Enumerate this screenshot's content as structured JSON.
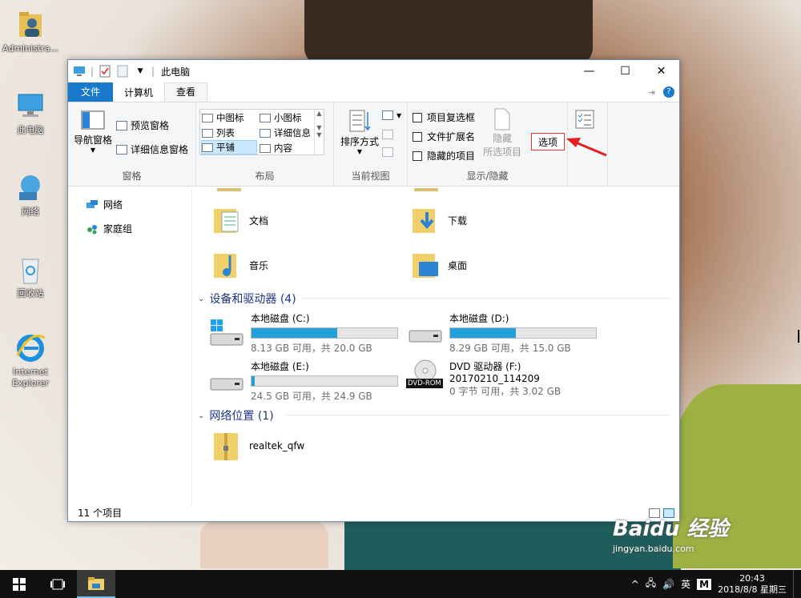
{
  "desktop": {
    "icons": [
      {
        "label": "Administra..."
      },
      {
        "label": "此电脑"
      },
      {
        "label": "网络"
      },
      {
        "label": "回收站"
      },
      {
        "label": "Internet Explorer"
      }
    ]
  },
  "window": {
    "title": "此电脑",
    "tabs": {
      "file": "文件",
      "computer": "计算机",
      "view": "查看"
    },
    "ribbon": {
      "panes": {
        "nav_pane": "导航窗格",
        "preview_pane": "预览窗格",
        "details_pane": "详细信息窗格",
        "label": "窗格"
      },
      "layout": {
        "items": [
          "中图标",
          "小图标",
          "列表",
          "详细信息",
          "平铺",
          "内容"
        ],
        "label": "布局"
      },
      "current_view": {
        "sort_by": "排序方式",
        "label": "当前视图"
      },
      "show_hide": {
        "item_checkboxes": "项目复选框",
        "file_extensions": "文件扩展名",
        "hidden_items": "隐藏的项目",
        "hide_selected_line1": "隐藏",
        "hide_selected_line2": "所选项目",
        "label": "显示/隐藏"
      },
      "options": "选项"
    },
    "nav": [
      {
        "label": "网络"
      },
      {
        "label": "家庭组"
      }
    ],
    "folders": [
      {
        "label": "文档"
      },
      {
        "label": "下载"
      },
      {
        "label": "音乐"
      },
      {
        "label": "桌面"
      }
    ],
    "devices_header": "设备和驱动器 (4)",
    "drives": [
      {
        "name": "本地磁盘 (C:)",
        "info": "8.13 GB 可用，共 20.0 GB",
        "used_fraction": 0.59
      },
      {
        "name": "本地磁盘 (D:)",
        "info": "8.29 GB 可用，共 15.0 GB",
        "used_fraction": 0.45
      },
      {
        "name": "本地磁盘 (E:)",
        "info": "24.5 GB 可用，共 24.9 GB",
        "used_fraction": 0.02
      },
      {
        "name": "DVD 驱动器 (F:)",
        "volume": "20170210_114209",
        "info": "0 字节 可用，共 3.02 GB",
        "badge": "DVD-ROM"
      }
    ],
    "network_header": "网络位置 (1)",
    "network_items": [
      {
        "label": "realtek_qfw"
      }
    ],
    "status": "11 个项目"
  },
  "taskbar": {
    "ime": "英",
    "ime2": "M",
    "time": "20:43",
    "date": "2018/8/8 星期三"
  },
  "watermark": {
    "brand": "Baidu 经验",
    "url": "jingyan.baidu.com"
  },
  "colors": {
    "accent": "#1979ca",
    "drive_bar": "#26a0da",
    "highlight_box": "#e03030"
  }
}
